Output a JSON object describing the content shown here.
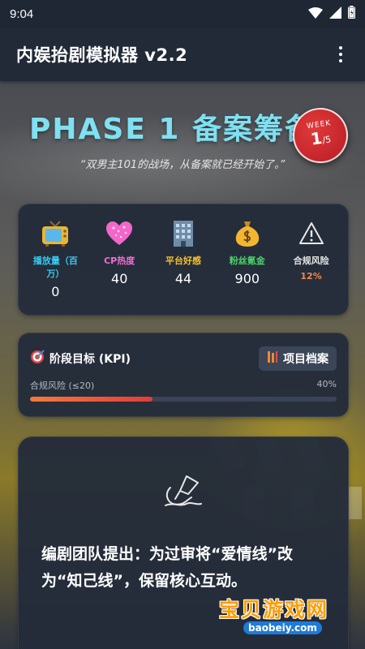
{
  "status": {
    "time": "9:04",
    "icons": [
      "wifi-icon",
      "signal-icon",
      "battery-icon"
    ]
  },
  "app": {
    "title": "内娱抬剧模拟器 v2.2",
    "menu_icon": "more-vert-icon"
  },
  "phase": {
    "title": "PHASE 1 备案筹备",
    "week_label": "WEEK",
    "week_current": "1",
    "week_total": "/5",
    "quote": "“双男主101的战场，从备案就已经开始了。”"
  },
  "stats": [
    {
      "icon": "tv-icon",
      "label": "播放量（百万）",
      "value": "0",
      "color": "#38c9ef"
    },
    {
      "icon": "heart-icon",
      "label": "CP热度",
      "value": "40",
      "color": "#f06dd0"
    },
    {
      "icon": "building-icon",
      "label": "平台好感",
      "value": "44",
      "color": "#f4c22c"
    },
    {
      "icon": "money-bag-icon",
      "label": "粉丝氪金",
      "value": "900",
      "color": "#4ed36a"
    },
    {
      "icon": "warning-icon",
      "label": "合规风险",
      "value": "12%",
      "color": "#f5874a"
    }
  ],
  "kpi": {
    "title": "阶段目标 (KPI)",
    "archive_label": "项目档案",
    "metric_label": "合规风险 (≤20)",
    "metric_percent": "40%",
    "progress": 0.4
  },
  "event": {
    "icon": "signing-hand-icon",
    "text": "编剧团队提出：为过审将“爱情线”改为“知己线”，保留核心互动。"
  },
  "watermark": {
    "title": "宝贝游戏网",
    "url": "baobeiy.com"
  },
  "colors": {
    "accent": "#7fe0f2",
    "badge": "#d12d33",
    "risk": "#f5874a"
  }
}
